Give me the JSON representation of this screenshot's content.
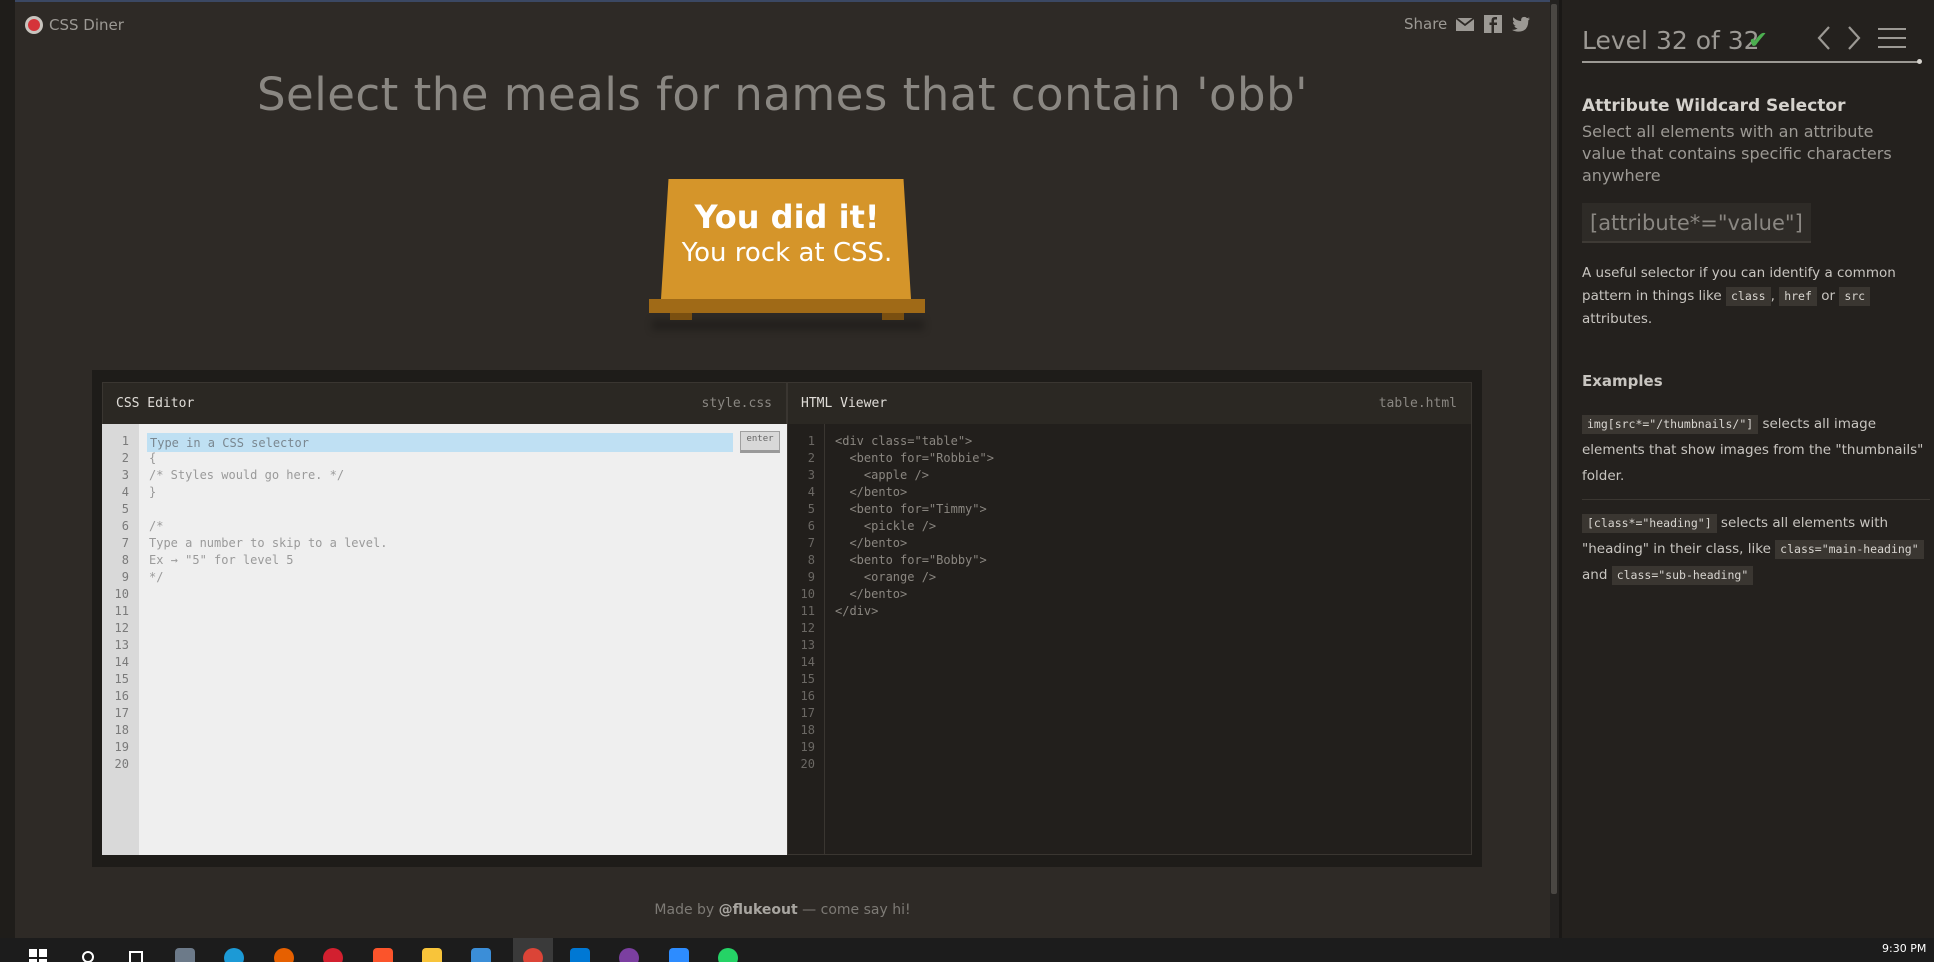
{
  "app": {
    "name": "CSS Diner"
  },
  "share": {
    "label": "Share",
    "icons": [
      "envelope-icon",
      "facebook-icon",
      "twitter-icon"
    ]
  },
  "instruction": "Select the meals for names that contain 'obb'",
  "win": {
    "line1": "You did it!",
    "line2": "You rock at CSS."
  },
  "css_editor": {
    "title": "CSS Editor",
    "file": "style.css",
    "placeholder": "Type in a CSS selector",
    "enter_label": "enter",
    "lines": [
      "",
      "{",
      "/* Styles would go here. */",
      "}",
      "",
      "/*",
      "Type a number to skip to a level.",
      "Ex → \"5\" for level 5",
      "*/",
      "",
      "",
      "",
      "",
      "",
      "",
      "",
      "",
      "",
      "",
      ""
    ],
    "line_numbers": [
      "1",
      "2",
      "3",
      "4",
      "5",
      "6",
      "7",
      "8",
      "9",
      "10",
      "11",
      "12",
      "13",
      "14",
      "15",
      "16",
      "17",
      "18",
      "19",
      "20"
    ]
  },
  "html_viewer": {
    "title": "HTML Viewer",
    "file": "table.html",
    "lines": [
      "<div class=\"table\">",
      "  <bento for=\"Robbie\">",
      "    <apple />",
      "  </bento>",
      "  <bento for=\"Timmy\">",
      "    <pickle />",
      "  </bento>",
      "  <bento for=\"Bobby\">",
      "    <orange />",
      "  </bento>",
      "</div>",
      "",
      "",
      "",
      "",
      "",
      "",
      "",
      "",
      ""
    ],
    "line_numbers": [
      "1",
      "2",
      "3",
      "4",
      "5",
      "6",
      "7",
      "8",
      "9",
      "10",
      "11",
      "12",
      "13",
      "14",
      "15",
      "16",
      "17",
      "18",
      "19",
      "20"
    ]
  },
  "footer": {
    "prefix": "Made by ",
    "author": "@flukeout",
    "suffix": " — come say hi!"
  },
  "sidebar": {
    "level": "Level 32 of 32",
    "check": "✔",
    "selector_name": "Attribute Wildcard Selector",
    "title": "Select all elements with an attribute value that contains specific characters anywhere",
    "syntax": "[attribute*=\"value\"]",
    "hint": {
      "text1": "A useful selector if you can identify a common pattern in things like",
      "tag1": "class",
      "sep1": ",",
      "tag2": "href",
      "sep2": "or",
      "tag3": "src",
      "text2": "attributes."
    },
    "examples_title": "Examples",
    "example1": {
      "code": "img[src*=\"/thumbnails/\"]",
      "text": "selects all image elements that show images from the \"thumbnails\" folder."
    },
    "example2": {
      "code": "[class*=\"heading\"]",
      "text1": "selects all elements with \"heading\" in their class, like",
      "code2": "class=\"main-heading\"",
      "text2": "and",
      "code3": "class=\"sub-heading\""
    }
  },
  "taskbar": {
    "items": [
      "windows-start-icon",
      "search-icon",
      "task-view-icon",
      "camera-app-icon",
      "edge-icon",
      "firefox-icon",
      "opera-icon",
      "brave-icon",
      "file-explorer-icon",
      "store-icon",
      "chrome-icon",
      "vscode-icon",
      "obs-icon",
      "zoom-icon",
      "whatsapp-icon"
    ],
    "time": "9:30 PM"
  },
  "colors": {
    "accent": "#d5952a",
    "check": "#4caf50",
    "highlight": "#bfe0f3"
  }
}
